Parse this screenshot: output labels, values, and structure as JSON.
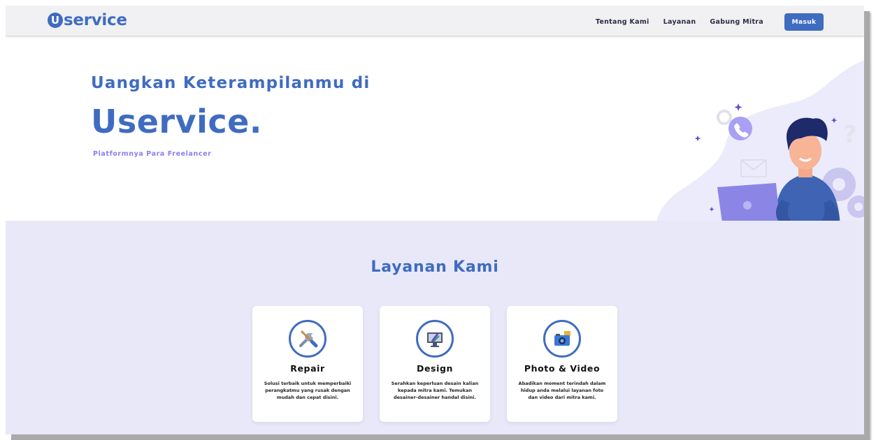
{
  "brand": {
    "logo_letter": "U",
    "logo_rest": "service",
    "color": "#3f6cc0"
  },
  "nav": {
    "links": [
      "Tentang Kami",
      "Layanan",
      "Gabung Mitra"
    ],
    "login_label": "Masuk"
  },
  "hero": {
    "subtitle": "Uangkan Keterampilanmu di",
    "title": "Uservice.",
    "tagline": "Platformnya Para Freelancer"
  },
  "services": {
    "title": "Layanan Kami",
    "cards": [
      {
        "title": "Repair",
        "icon": "tools-icon",
        "description": "Solusi terbaik untuk memperbaiki perangkatmu yang rusak dengan mudah dan cepat disini."
      },
      {
        "title": "Design",
        "icon": "design-monitor-icon",
        "description": "Serahkan keperluan desain kalian kepada mitra kami. Temukan desainer-desainer handal disini."
      },
      {
        "title": "Photo & Video",
        "icon": "camera-icon",
        "description": "Abadikan moment terindah dalam hidup anda melalui layanan foto dan video dari mitra kami."
      }
    ]
  },
  "colors": {
    "accent": "#3f6cc0",
    "tagline": "#8a7ff0",
    "section_bg": "#e8e8f8"
  }
}
